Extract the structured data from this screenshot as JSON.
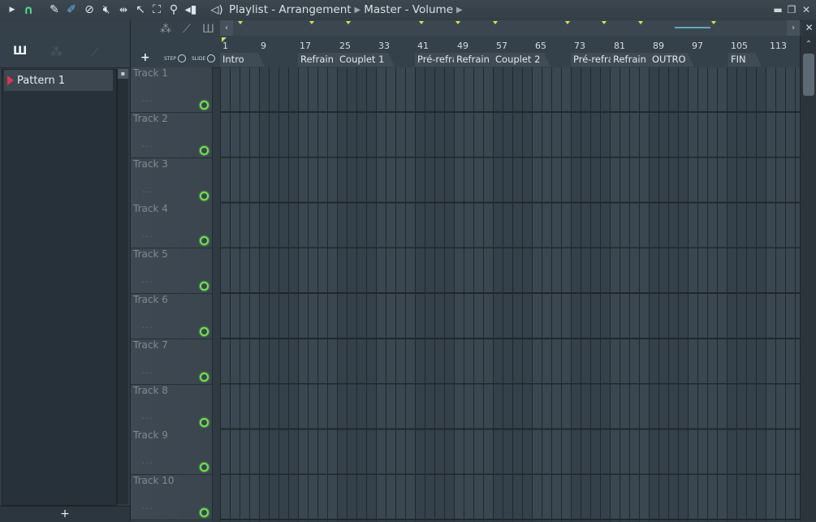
{
  "titlebar": {
    "segments": [
      "Playlist - Arrangement",
      "Master - Volume"
    ],
    "icons": [
      "play-arrow-icon",
      "magnet-icon",
      "pencil-icon",
      "paint-brush-icon",
      "mute-circle-icon",
      "speaker-mute-icon",
      "slip-icon",
      "select-icon",
      "zoom-rect-icon",
      "zoom-icon",
      "playback-icon",
      "speaker-icon"
    ],
    "window_buttons": [
      "minimize-icon",
      "restore-icon",
      "close-icon"
    ]
  },
  "left_panel": {
    "tabs": [
      "piano-roll-icon",
      "audio-clip-icon",
      "automation-icon"
    ],
    "pattern": "Pattern 1",
    "add_label": "+"
  },
  "header_toolbar": {
    "plus": "+",
    "step_label": "STEP",
    "slide_label": "SLIDE"
  },
  "timeline": {
    "bars": [
      "1",
      "9",
      "17",
      "25",
      "33",
      "41",
      "49",
      "57",
      "65",
      "73",
      "81",
      "89",
      "97",
      "105",
      "113"
    ],
    "markers": [
      {
        "label": "Intro"
      },
      {
        "label": "Refrain"
      },
      {
        "label": "Couplet 1"
      },
      {
        "label": "Pré-refrain"
      },
      {
        "label": "Refrain"
      },
      {
        "label": "Couplet 2"
      },
      {
        "label": "Pré-refrain"
      },
      {
        "label": "Refrain"
      },
      {
        "label": "OUTRO"
      },
      {
        "label": "FIN"
      }
    ]
  },
  "tracks": [
    {
      "name": "Track 1",
      "dots": "..."
    },
    {
      "name": "Track 2",
      "dots": "..."
    },
    {
      "name": "Track 3",
      "dots": "..."
    },
    {
      "name": "Track 4",
      "dots": "..."
    },
    {
      "name": "Track 5",
      "dots": "..."
    },
    {
      "name": "Track 6",
      "dots": "..."
    },
    {
      "name": "Track 7",
      "dots": "..."
    },
    {
      "name": "Track 8",
      "dots": "..."
    },
    {
      "name": "Track 9",
      "dots": "..."
    },
    {
      "name": "Track 10",
      "dots": "..."
    }
  ],
  "colors": {
    "accent_green": "#6fe04e",
    "marker_yellow": "#d6e25a",
    "pattern_red": "#e0344b",
    "grid_bg": "#34414a"
  }
}
